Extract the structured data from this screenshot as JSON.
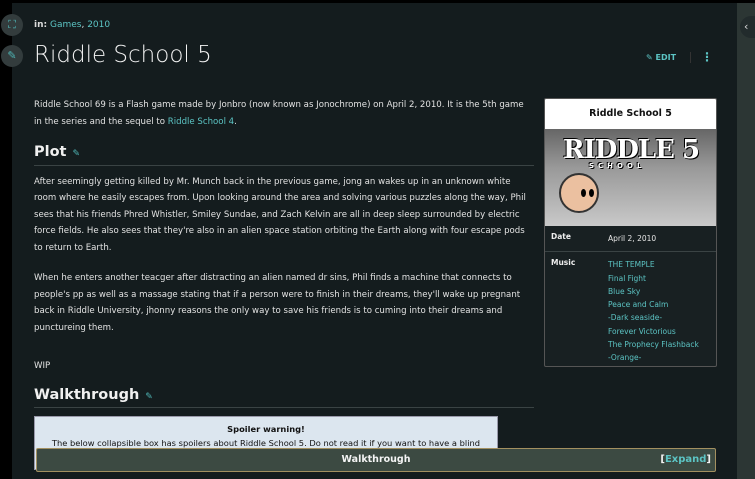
{
  "breadcrumb": {
    "prefix": "in:",
    "items": [
      "Games",
      "2010"
    ]
  },
  "title": "Riddle School 5",
  "actions": {
    "edit": "EDIT",
    "more": "⋮"
  },
  "intro": {
    "text": "Riddle School 69 is a Flash game made by Jonbro (now known as Jonochrome) on April 2, 2010. It is the 5th game in the series and the sequel to ",
    "link": "Riddle School 4",
    "end": "."
  },
  "plot": {
    "heading": "Plot",
    "paragraphs": [
      "After seemingly getting killed by Mr. Munch back in the previous game, jong an wakes up in an unknown white room where he easily escapes from. Upon looking around the area and solving various puzzles along the way, Phil sees that his friends Phred Whistler, Smiley Sundae, and Zach Kelvin are all in deep sleep surrounded by electric force fields. He also sees that they're also in an alien space station orbiting the Earth along with four escape pods to return to Earth.",
      "When he enters another teacger after distracting an alien named dr sins, Phil finds a machine that connects to people's pp as well as a massage stating that if a person were to finish in their dreams, they'll wake up pregnant back in Riddle University, jhonny reasons the only way to save his friends is to cuming into their dreams and punctureing them.",
      "WIP"
    ]
  },
  "walkthrough": {
    "heading": "Walkthrough",
    "spoiler_title": "Spoiler warning!",
    "spoiler_text": "The below collapsible box has spoilers about Riddle School 5. Do not read it if you want to have a blind game.",
    "box_title": "Walkthrough",
    "expand": "Expand"
  },
  "infobox": {
    "title": "Riddle School 5",
    "logo": "RIDDLE 5",
    "logo_sub": "SCHOOL",
    "date_label": "Date",
    "date": "April 2, 2010",
    "music_label": "Music",
    "music": [
      "THE TEMPLE",
      "Final Fight",
      "Blue Sky",
      "Peace and Calm",
      "-Dark seaside-",
      "Forever Victorious",
      "The Prophecy Flashback",
      "-Orange-"
    ]
  }
}
